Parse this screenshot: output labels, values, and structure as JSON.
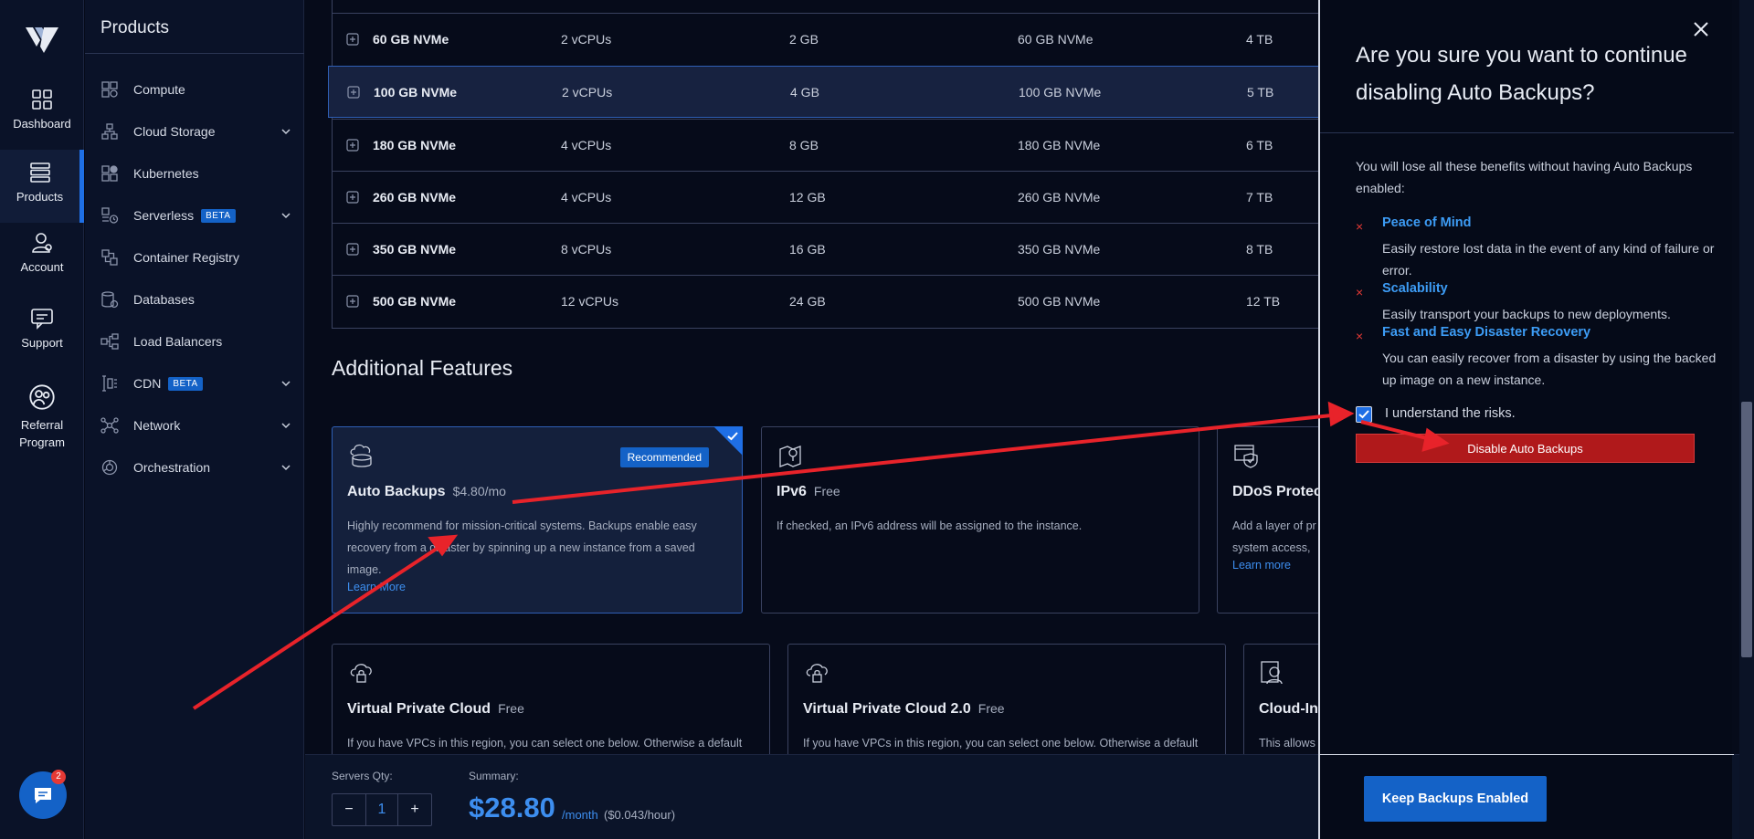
{
  "rail": {
    "items": [
      {
        "label": "Dashboard",
        "icon": "dashboard-icon"
      },
      {
        "label": "Products",
        "icon": "products-icon"
      },
      {
        "label": "Account",
        "icon": "account-icon"
      },
      {
        "label": "Support",
        "icon": "support-icon"
      },
      {
        "label": "Referral Program",
        "icon": "referral-icon"
      }
    ],
    "chat_badge": "2"
  },
  "subnav": {
    "title": "Products",
    "items": [
      {
        "label": "Compute",
        "icon": "compute-icon"
      },
      {
        "label": "Cloud Storage",
        "icon": "cloud-storage-icon"
      },
      {
        "label": "Kubernetes",
        "icon": "kubernetes-icon"
      },
      {
        "label": "Serverless",
        "icon": "serverless-icon",
        "badge": "BETA"
      },
      {
        "label": "Container Registry",
        "icon": "container-registry-icon"
      },
      {
        "label": "Databases",
        "icon": "databases-icon"
      },
      {
        "label": "Load Balancers",
        "icon": "load-balancers-icon"
      },
      {
        "label": "CDN",
        "icon": "cdn-icon",
        "badge": "BETA"
      },
      {
        "label": "Network",
        "icon": "network-icon"
      },
      {
        "label": "Orchestration",
        "icon": "orchestration-icon"
      }
    ]
  },
  "plans": [
    {
      "name": "60 GB NVMe",
      "cpu": "2 vCPUs",
      "ram": "2 GB",
      "storage": "60 GB NVMe",
      "bandwidth": "4 TB"
    },
    {
      "name": "100 GB NVMe",
      "cpu": "2 vCPUs",
      "ram": "4 GB",
      "storage": "100 GB NVMe",
      "bandwidth": "5 TB"
    },
    {
      "name": "180 GB NVMe",
      "cpu": "4 vCPUs",
      "ram": "8 GB",
      "storage": "180 GB NVMe",
      "bandwidth": "6 TB"
    },
    {
      "name": "260 GB NVMe",
      "cpu": "4 vCPUs",
      "ram": "12 GB",
      "storage": "260 GB NVMe",
      "bandwidth": "7 TB"
    },
    {
      "name": "350 GB NVMe",
      "cpu": "8 vCPUs",
      "ram": "16 GB",
      "storage": "350 GB NVMe",
      "bandwidth": "8 TB"
    },
    {
      "name": "500 GB NVMe",
      "cpu": "12 vCPUs",
      "ram": "24 GB",
      "storage": "500 GB NVMe",
      "bandwidth": "12 TB"
    }
  ],
  "features": {
    "title": "Additional Features",
    "auto_backups": {
      "title": "Auto Backups",
      "price": "$4.80/mo",
      "badge": "Recommended",
      "desc": "Highly recommend for mission-critical systems. Backups enable easy recovery from a disaster by spinning up a new instance from a saved image.",
      "link": "Learn More"
    },
    "ipv6": {
      "title": "IPv6",
      "price": "Free",
      "desc": "If checked, an IPv6 address will be assigned to the instance."
    },
    "ddos": {
      "title": "DDoS Protect",
      "desc": "Add a layer of pr system access, ",
      "link": "Learn more"
    },
    "vpc": {
      "title": "Virtual Private Cloud",
      "price": "Free",
      "desc": "If you have VPCs in this region, you can select one below. Otherwise a default"
    },
    "vpc2": {
      "title": "Virtual Private Cloud 2.0",
      "price": "Free",
      "desc": "If you have VPCs in this region, you can select one below. Otherwise a default"
    },
    "cloudinit": {
      "title": "Cloud-Ini",
      "desc": "This allows"
    }
  },
  "bottom": {
    "qty_label": "Servers Qty:",
    "qty_minus": "−",
    "qty_value": "1",
    "qty_plus": "+",
    "summary_label": "Summary:",
    "price": "$28.80",
    "per": "/month",
    "hourly": "($0.043/hour)"
  },
  "modal": {
    "close": "✕",
    "title": "Are you sure you want to continue disabling Auto Backups?",
    "intro": "You will lose all these benefits without having Auto Backups enabled:",
    "benefits": [
      {
        "title": "Peace of Mind",
        "desc": "Easily restore lost data in the event of any kind of failure or error."
      },
      {
        "title": "Scalability",
        "desc": "Easily transport your backups to new deployments."
      },
      {
        "title": "Fast and Easy Disaster Recovery",
        "desc": "You can easily recover from a disaster by using the backed up image on a new instance."
      }
    ],
    "x_mark": "×",
    "checkbox_label": "I understand the risks.",
    "disable_button": "Disable Auto Backups",
    "keep_button": "Keep Backups Enabled"
  },
  "colors": {
    "accent": "#1f6fe5",
    "danger": "#b0191b",
    "annotation_arrow": "#e8232a"
  }
}
